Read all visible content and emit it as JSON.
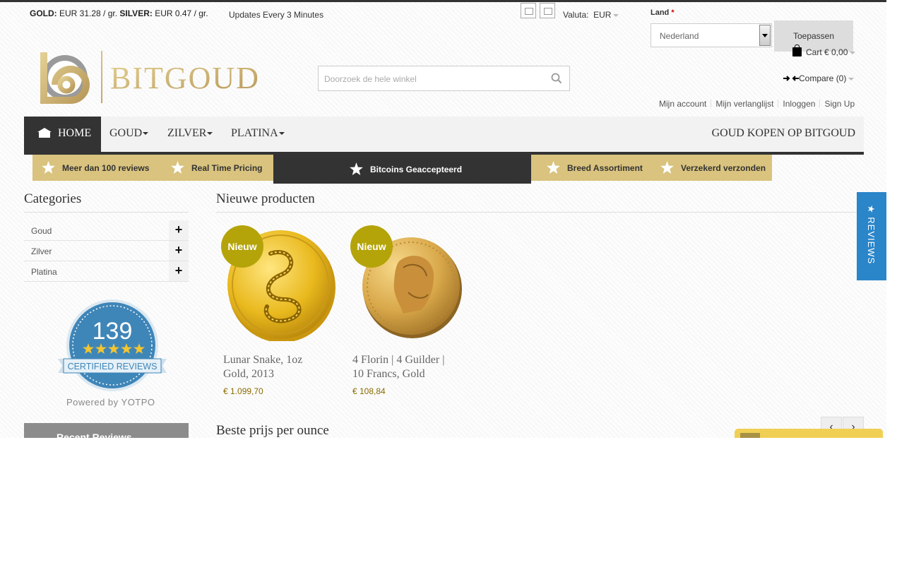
{
  "ticker": {
    "gold_label": "GOLD:",
    "gold_value": "EUR 31.28 / gr.",
    "silver_label": "SILVER:",
    "silver_value": "EUR 0.47 / gr.",
    "updates": "Updates Every 3 Minutes"
  },
  "currency": {
    "label": "Valuta:",
    "value": "EUR"
  },
  "country": {
    "label": "Land",
    "required": "*",
    "value": "Nederland",
    "apply": "Toepassen"
  },
  "cart": {
    "label": "Cart € 0,00"
  },
  "compare": {
    "label": "Compare (0)"
  },
  "logo": {
    "text": "BITGOUD"
  },
  "search": {
    "placeholder": "Doorzoek de hele winkel"
  },
  "account_links": [
    "Mijn account",
    "Mijn verlanglijst",
    "Inloggen",
    "Sign Up"
  ],
  "nav": {
    "home": "HOME",
    "items": [
      "GOUD",
      "ZILVER",
      "PLATINA"
    ],
    "right": "GOUD KOPEN OP BITGOUD"
  },
  "usps": [
    "Meer dan 100 reviews",
    "Real Time Pricing",
    "Bitcoins Geaccepteerd",
    "Breed Assortiment",
    "Verzekerd verzonden"
  ],
  "sidebar": {
    "title": "Categories",
    "categories": [
      "Goud",
      "Zilver",
      "Platina"
    ],
    "badge": {
      "count": "139",
      "text": "CERTIFIED REVIEWS",
      "powered": "Powered by YOTPO",
      "stars": 5
    },
    "recent_button": "Recent Reviews"
  },
  "main": {
    "new_title": "Nieuwe producten",
    "products": [
      {
        "badge": "Nieuw",
        "name_line1": "Lunar Snake, 1oz",
        "name_line2": "Gold, 2013",
        "price": "€ 1.099,70"
      },
      {
        "badge": "Nieuw",
        "name_line1": "4 Florin | 4 Guilder |",
        "name_line2": "10 Francs, Gold",
        "price": "€ 108,84"
      }
    ],
    "best_title": "Beste prijs per ounce"
  },
  "reviews_tab": {
    "label": "★ REVIEWS"
  },
  "colors": {
    "gold": "#d9c37e",
    "dark": "#333333",
    "nieuw": "#b4a40a",
    "reviews_blue": "#2a85c9"
  }
}
